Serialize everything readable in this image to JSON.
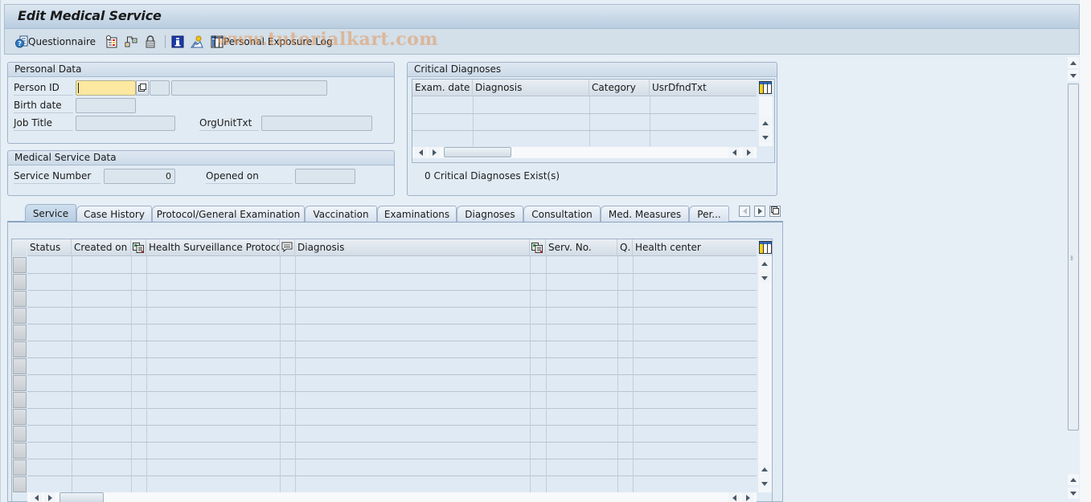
{
  "window": {
    "title": "Edit Medical Service"
  },
  "toolbar": {
    "items": [
      {
        "icon": "questionnaire-icon",
        "label": "Questionnaire"
      },
      {
        "icon": "checklist-icon",
        "label": ""
      },
      {
        "icon": "hierarchy-icon",
        "label": ""
      },
      {
        "icon": "lock-icon",
        "label": ""
      },
      {
        "icon": "info-icon",
        "label": ""
      },
      {
        "icon": "person-icon",
        "label": ""
      },
      {
        "icon": "table-icon",
        "label": "Personal Exposure Log"
      }
    ],
    "watermark": "www.tutorialkart.com"
  },
  "personal_data": {
    "title": "Personal Data",
    "person_id": {
      "label": "Person ID",
      "value": "",
      "extra": "",
      "name": ""
    },
    "birth_date": {
      "label": "Birth date",
      "value": ""
    },
    "job_title": {
      "label": "Job Title",
      "value": ""
    },
    "org_unit": {
      "label": "OrgUnitTxt",
      "value": ""
    }
  },
  "medical_service_data": {
    "title": "Medical Service Data",
    "service_number": {
      "label": "Service Number",
      "value": "0"
    },
    "opened_on": {
      "label": "Opened on",
      "value": ""
    }
  },
  "critical_diagnoses": {
    "title": "Critical Diagnoses",
    "columns": [
      "Exam. date",
      "Diagnosis",
      "Category",
      "UsrDfndTxt"
    ],
    "rows": [],
    "status": "0 Critical Diagnoses Exist(s)"
  },
  "tabs": {
    "items": [
      {
        "label": "Service",
        "active": true
      },
      {
        "label": "Case History",
        "active": false
      },
      {
        "label": "Protocol/General Examination",
        "active": false
      },
      {
        "label": "Vaccination",
        "active": false
      },
      {
        "label": "Examinations",
        "active": false
      },
      {
        "label": "Diagnoses",
        "active": false
      },
      {
        "label": "Consultation",
        "active": false
      },
      {
        "label": "Med. Measures",
        "active": false
      },
      {
        "label": "Per...",
        "active": false
      }
    ]
  },
  "service_table": {
    "columns": [
      {
        "label": "Status",
        "icon": ""
      },
      {
        "label": "Created on",
        "icon": ""
      },
      {
        "label": "",
        "icon": "protocol-icon"
      },
      {
        "label": "Health Surveillance Protoco...",
        "icon": ""
      },
      {
        "label": "",
        "icon": "comment-icon"
      },
      {
        "label": "Diagnosis",
        "icon": ""
      },
      {
        "label": "",
        "icon": "protocol-icon"
      },
      {
        "label": "Serv. No.",
        "icon": ""
      },
      {
        "label": "Q.",
        "icon": ""
      },
      {
        "label": "Health center",
        "icon": ""
      }
    ],
    "rows": []
  }
}
